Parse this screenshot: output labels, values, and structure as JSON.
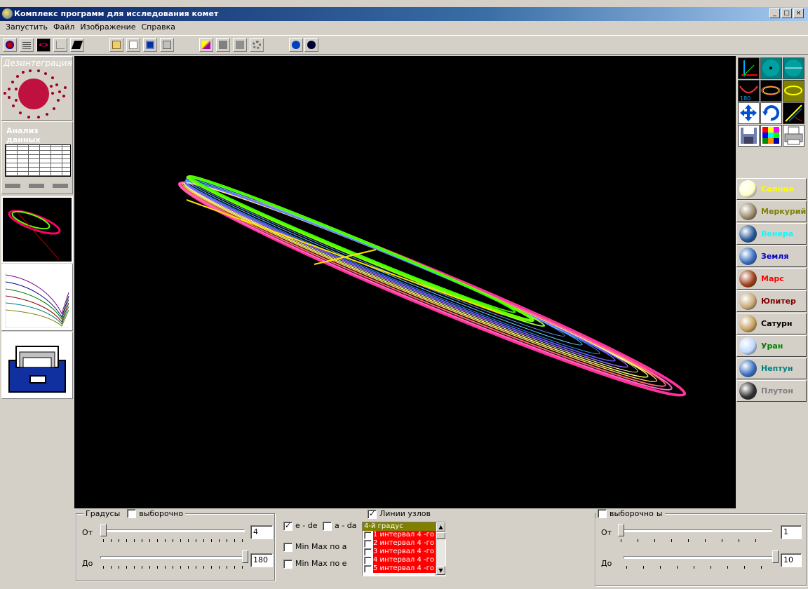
{
  "window": {
    "title": "Комплекс программ для исследования комет",
    "min": "_",
    "max": "□",
    "close": "×"
  },
  "menu": [
    {
      "label": "Запустить"
    },
    {
      "label": "Файл"
    },
    {
      "label": "Изображение"
    },
    {
      "label": "Справка"
    }
  ],
  "left": {
    "disintegration_label": "Дезинтеграция",
    "analysis_label": "Анализ данных"
  },
  "planets": [
    {
      "label": "Солнце",
      "color": "#ffff00",
      "ball": "#ffffcc"
    },
    {
      "label": "Меркурий",
      "color": "#808000",
      "ball": "#9a8a6a"
    },
    {
      "label": "Венера",
      "color": "#00ffff",
      "ball": "#2a5a9a"
    },
    {
      "label": "Земля",
      "color": "#0000c0",
      "ball": "#3a70c0"
    },
    {
      "label": "Марс",
      "color": "#ff0000",
      "ball": "#a0401a"
    },
    {
      "label": "Юпитер",
      "color": "#800000",
      "ball": "#c8a878"
    },
    {
      "label": "Сатурн",
      "color": "#000000",
      "ball": "#c8a060"
    },
    {
      "label": "Уран",
      "color": "#008000",
      "ball": "#c0d8ff"
    },
    {
      "label": "Нептун",
      "color": "#008080",
      "ball": "#3a70c0"
    },
    {
      "label": "Плутон",
      "color": "#808080",
      "ball": "#303030"
    }
  ],
  "bottom": {
    "degrees": {
      "title": "Градусы",
      "selective_label": "выборочно",
      "from_label": "От",
      "to_label": "До",
      "from_value": "4",
      "to_value": "180",
      "from_fraction": 0.0,
      "to_fraction": 1.0
    },
    "options": {
      "e_de_label": "e - de",
      "e_de_checked": true,
      "a_da_label": "a - da",
      "a_da_checked": false,
      "minmax_a_label": "Min Max по a",
      "minmax_a_checked": false,
      "minmax_e_label": "Min Max по e",
      "minmax_e_checked": false,
      "node_lines_label": "Линии узлов",
      "node_lines_checked": true
    },
    "list": {
      "header": "4-й градус",
      "items": [
        "1 интервал 4 -го",
        "2 интервал 4 -го",
        "3 интервал 4 -го",
        "4 интервал 4 -го",
        "5 интервал 4 -го"
      ]
    },
    "right": {
      "selective_label": "выборочно",
      "suffix_label": "ы",
      "from_label": "От",
      "to_label": "До",
      "from_value": "1",
      "to_value": "10",
      "from_fraction": 0.0,
      "to_fraction": 1.0
    }
  }
}
